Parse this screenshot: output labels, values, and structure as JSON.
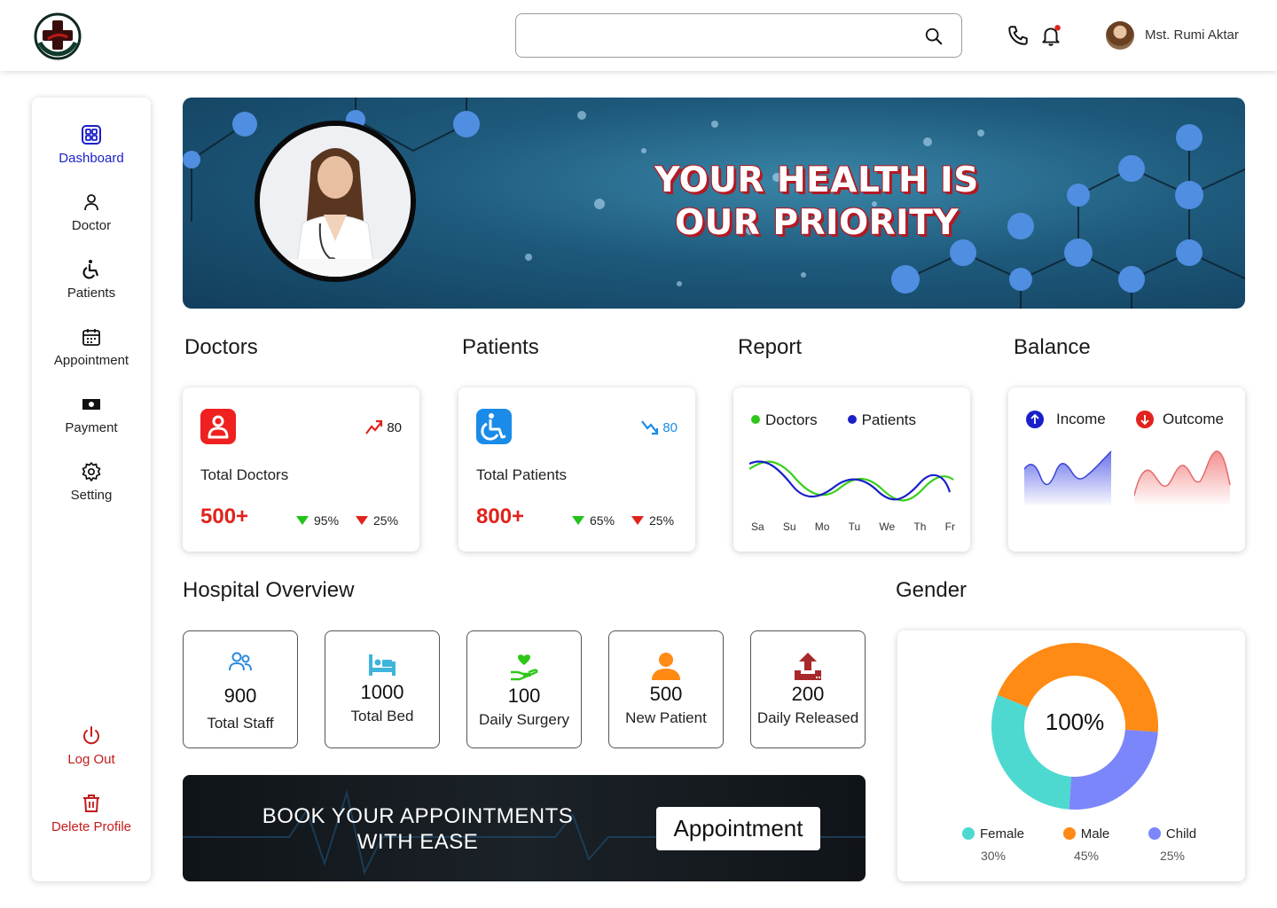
{
  "header": {
    "search_placeholder": "",
    "user_name": "Mst. Rumi Aktar"
  },
  "sidebar": {
    "items": [
      {
        "label": "Dashboard",
        "icon": "grid-icon"
      },
      {
        "label": "Doctor",
        "icon": "user-icon"
      },
      {
        "label": "Patients",
        "icon": "wheelchair-icon"
      },
      {
        "label": "Appointment",
        "icon": "calendar-icon"
      },
      {
        "label": "Payment",
        "icon": "money-icon"
      },
      {
        "label": "Setting",
        "icon": "gear-icon"
      }
    ],
    "logout": "Log Out",
    "delete_profile": "Delete Profile"
  },
  "hero": {
    "line1": "YOUR HEALTH IS",
    "line2": "OUR PRIORITY"
  },
  "sections": {
    "doctors": "Doctors",
    "patients": "Patients",
    "report": "Report",
    "balance": "Balance",
    "overview": "Hospital Overview",
    "gender": "Gender"
  },
  "doctors_card": {
    "label": "Total Doctors",
    "value": "500+",
    "trend": "80",
    "up_pct": "95%",
    "down_pct": "25%"
  },
  "patients_card": {
    "label": "Total Patients",
    "value": "800+",
    "trend": "80",
    "up_pct": "65%",
    "down_pct": "25%"
  },
  "report_card": {
    "legend": [
      "Doctors",
      "Patients"
    ],
    "days": [
      "Sa",
      "Su",
      "Mo",
      "Tu",
      "We",
      "Th",
      "Fr"
    ]
  },
  "balance_card": {
    "income": "Income",
    "outcome": "Outcome"
  },
  "overview": [
    {
      "value": "900",
      "label": "Total Staff"
    },
    {
      "value": "1000",
      "label": "Total Bed"
    },
    {
      "value": "100",
      "label": "Daily Surgery"
    },
    {
      "value": "500",
      "label": "New Patient"
    },
    {
      "value": "200",
      "label": "Daily Released"
    }
  ],
  "book": {
    "line1": "BOOK YOUR APPOINTMENTS",
    "line2": "WITH EASE",
    "button": "Appointment"
  },
  "chart_data": {
    "type": "pie",
    "center_label": "100%",
    "categories": [
      "Female",
      "Male",
      "Child"
    ],
    "values": [
      30,
      45,
      25
    ],
    "labels": [
      "30%",
      "45%",
      "25%"
    ],
    "colors": [
      "#4dd9d0",
      "#ff8a14",
      "#7b86fa"
    ]
  }
}
